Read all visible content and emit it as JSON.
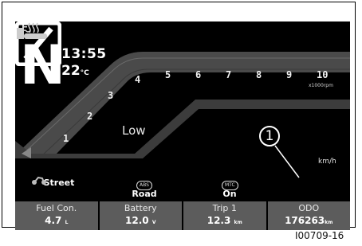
{
  "display": {
    "gear": "N",
    "time": "13:55",
    "temperature": "22",
    "temperature_unit": "°C",
    "rpm_ticks": [
      "1",
      "2",
      "3",
      "4",
      "5",
      "6",
      "7",
      "8",
      "9",
      "10"
    ],
    "rpm_unit": "x1000rpm",
    "coolant_label": "Low",
    "speed_unit": "km/h",
    "callout": "1"
  },
  "modes": [
    {
      "icon": "motorcycle-icon",
      "label": "Street"
    },
    {
      "icon": "abs-icon",
      "badge": "ABS",
      "label": "Road"
    },
    {
      "icon": "mtc-icon",
      "badge": "MTC",
      "label": "On"
    }
  ],
  "stats": [
    {
      "label": "Fuel Con.",
      "value": "4.7",
      "unit": "L"
    },
    {
      "label": "Battery",
      "value": "12.0",
      "unit": "V"
    },
    {
      "label": "Trip 1",
      "value": "12.3",
      "unit": "km"
    },
    {
      "label": "ODO",
      "value": "176263",
      "unit": "km"
    }
  ],
  "figure_id": "I00709-16",
  "colors": {
    "background": "#000000",
    "bar": "#5c5c5c",
    "text": "#ffffff"
  }
}
